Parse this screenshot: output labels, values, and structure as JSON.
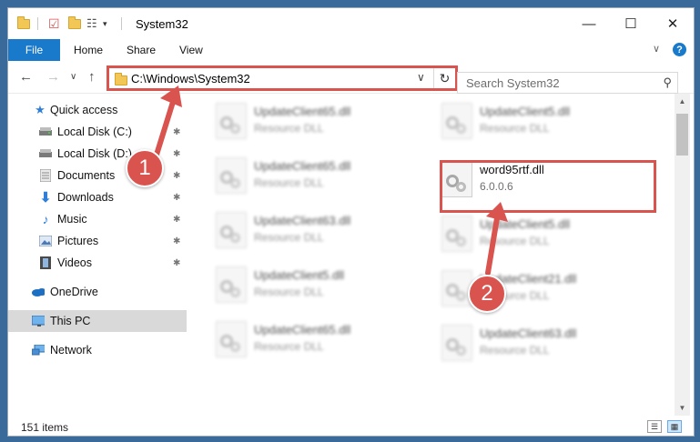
{
  "window": {
    "title": "System32",
    "controls": {
      "minimize": "—",
      "maximize": "☐",
      "close": "✕"
    }
  },
  "ribbon": {
    "tabs": [
      "File",
      "Home",
      "Share",
      "View"
    ],
    "help": "?",
    "collapse": "∨"
  },
  "nav": {
    "back": "←",
    "forward": "→",
    "recent": "∨",
    "up": "↑",
    "address": "C:\\Windows\\System32",
    "address_chevron": "∨",
    "refresh": "↻",
    "search_placeholder": "Search System32",
    "search_icon": "⚲"
  },
  "sidebar": {
    "items": [
      {
        "label": "Quick access",
        "icon": "star-icon",
        "pinned": false
      },
      {
        "label": "Local Disk (C:)",
        "icon": "drive-icon",
        "pinned": true
      },
      {
        "label": "Local Disk (D:)",
        "icon": "drive-icon",
        "pinned": true
      },
      {
        "label": "Documents",
        "icon": "documents-icon",
        "pinned": true
      },
      {
        "label": "Downloads",
        "icon": "download-icon",
        "pinned": true
      },
      {
        "label": "Music",
        "icon": "music-icon",
        "pinned": true
      },
      {
        "label": "Pictures",
        "icon": "pictures-icon",
        "pinned": true
      },
      {
        "label": "Videos",
        "icon": "videos-icon",
        "pinned": true
      },
      {
        "label": "OneDrive",
        "icon": "cloud-icon",
        "pinned": false
      },
      {
        "label": "This PC",
        "icon": "monitor-icon",
        "pinned": false,
        "selected": true
      },
      {
        "label": "Network",
        "icon": "network-icon",
        "pinned": false
      }
    ],
    "pin_glyph": "📌"
  },
  "files": {
    "left_column": [
      {
        "name": "UpdateClient65.dll",
        "type": "Resource DLL"
      },
      {
        "name": "UpdateClient65.dll",
        "type": "Resource DLL"
      },
      {
        "name": "UpdateClient63.dll",
        "type": "Resource DLL"
      },
      {
        "name": "UpdateClient5.dll",
        "type": "Resource DLL"
      },
      {
        "name": "UpdateClient65.dll",
        "type": "Resource DLL"
      }
    ],
    "right_column": [
      {
        "name": "UpdateClient5.dll",
        "type": "Resource DLL"
      },
      {
        "name": "word95rtf.dll",
        "type": "6.0.0.6",
        "highlighted": true
      },
      {
        "name": "UpdateClient5.dll",
        "type": "Resource DLL"
      },
      {
        "name": "UpdateClient21.dll",
        "type": "Resource DLL"
      },
      {
        "name": "UpdateClient63.dll",
        "type": "Resource DLL"
      }
    ]
  },
  "status": {
    "item_count": "151 items"
  },
  "annotations": {
    "step1": "1",
    "step2": "2",
    "color": "#d9534f"
  }
}
